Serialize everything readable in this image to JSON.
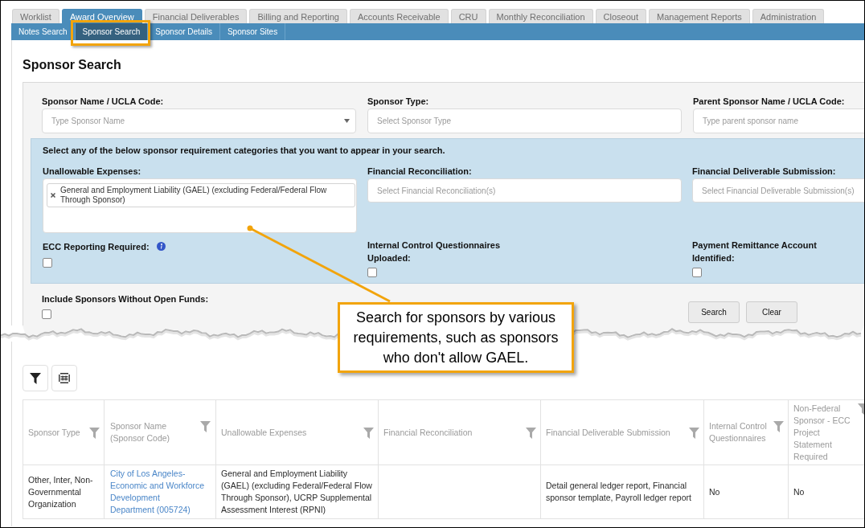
{
  "main_tabs": [
    {
      "label": "Worklist",
      "selected": false
    },
    {
      "label": "Award Overview",
      "selected": true
    },
    {
      "label": "Financial Deliverables",
      "selected": false
    },
    {
      "label": "Billing and Reporting",
      "selected": false
    },
    {
      "label": "Accounts Receivable",
      "selected": false
    },
    {
      "label": "CRU",
      "selected": false
    },
    {
      "label": "Monthly Reconciliation",
      "selected": false
    },
    {
      "label": "Closeout",
      "selected": false
    },
    {
      "label": "Management Reports",
      "selected": false
    },
    {
      "label": "Administration",
      "selected": false
    }
  ],
  "sub_tabs": [
    {
      "label": "Notes Search",
      "selected": false,
      "highlighted": false
    },
    {
      "label": "Sponsor Search",
      "selected": true,
      "highlighted": true
    },
    {
      "label": "Sponsor Details",
      "selected": false,
      "highlighted": false
    },
    {
      "label": "Sponsor Sites",
      "selected": false,
      "highlighted": false
    }
  ],
  "page_title": "Sponsor Search",
  "search_fields": [
    {
      "label": "Sponsor Name / UCLA Code:",
      "kind": "combobox",
      "placeholder": "Type Sponsor Name"
    },
    {
      "label": "Sponsor Type:",
      "kind": "text",
      "placeholder": "Select Sponsor Type"
    },
    {
      "label": "Parent Sponsor Name / UCLA Code:",
      "kind": "text",
      "placeholder": "Type parent sponsor name"
    }
  ],
  "requirements": {
    "instruction": "Select any of the below sponsor requirement categories that you want to appear in your search.",
    "fields": [
      {
        "label": "Unallowable Expenses:",
        "kind": "multiselect",
        "tags": [
          "General and Employment Liability (GAEL) (excluding Federal/Federal Flow Through Sponsor)"
        ]
      },
      {
        "label": "Financial Reconciliation:",
        "kind": "text",
        "placeholder": "Select Financial Reconciliation(s)"
      },
      {
        "label": "Financial Deliverable Submission:",
        "kind": "text",
        "placeholder": "Select Financial Deliverable Submission(s)"
      }
    ],
    "checkboxes": [
      {
        "label": "ECC Reporting Required:",
        "checked": false,
        "info": true
      },
      {
        "label": "Internal Control Questionnaires Uploaded:",
        "checked": false,
        "info": false
      },
      {
        "label": "Payment Remittance Account Identified:",
        "checked": false,
        "info": false
      }
    ]
  },
  "open_funds_option": {
    "label": "Include Sponsors Without Open Funds:",
    "checked": false
  },
  "buttons": [
    "Search",
    "Clear"
  ],
  "callout": "Search for sponsors by various requirements, such as sponsors who don't allow GAEL.",
  "results_table": {
    "columns": [
      "Sponsor Type",
      "Sponsor Name (Sponsor Code)",
      "Unallowable Expenses",
      "Financial Reconciliation",
      "Financial Deliverable Submission",
      "Internal Control Questionnaires",
      "Non-Federal Sponsor - ECC Project Statement Required"
    ],
    "rows": [
      {
        "sponsor_type": "Other, Inter, Non-Governmental Organization",
        "sponsor_name": "City of Los Angeles-Economic and Workforce Development Department (005724)",
        "unallowable_expenses": "General and Employment Liability (GAEL) (excluding Federal/Federal Flow Through Sponsor), UCRP Supplemental Assessment Interest (RPNI)",
        "financial_deliverable_submission": "Detail general ledger report, Financial sponsor template, Payroll ledger report",
        "internal_control_questionnaires": "No",
        "ecc_project_statement_required": "No"
      }
    ]
  }
}
